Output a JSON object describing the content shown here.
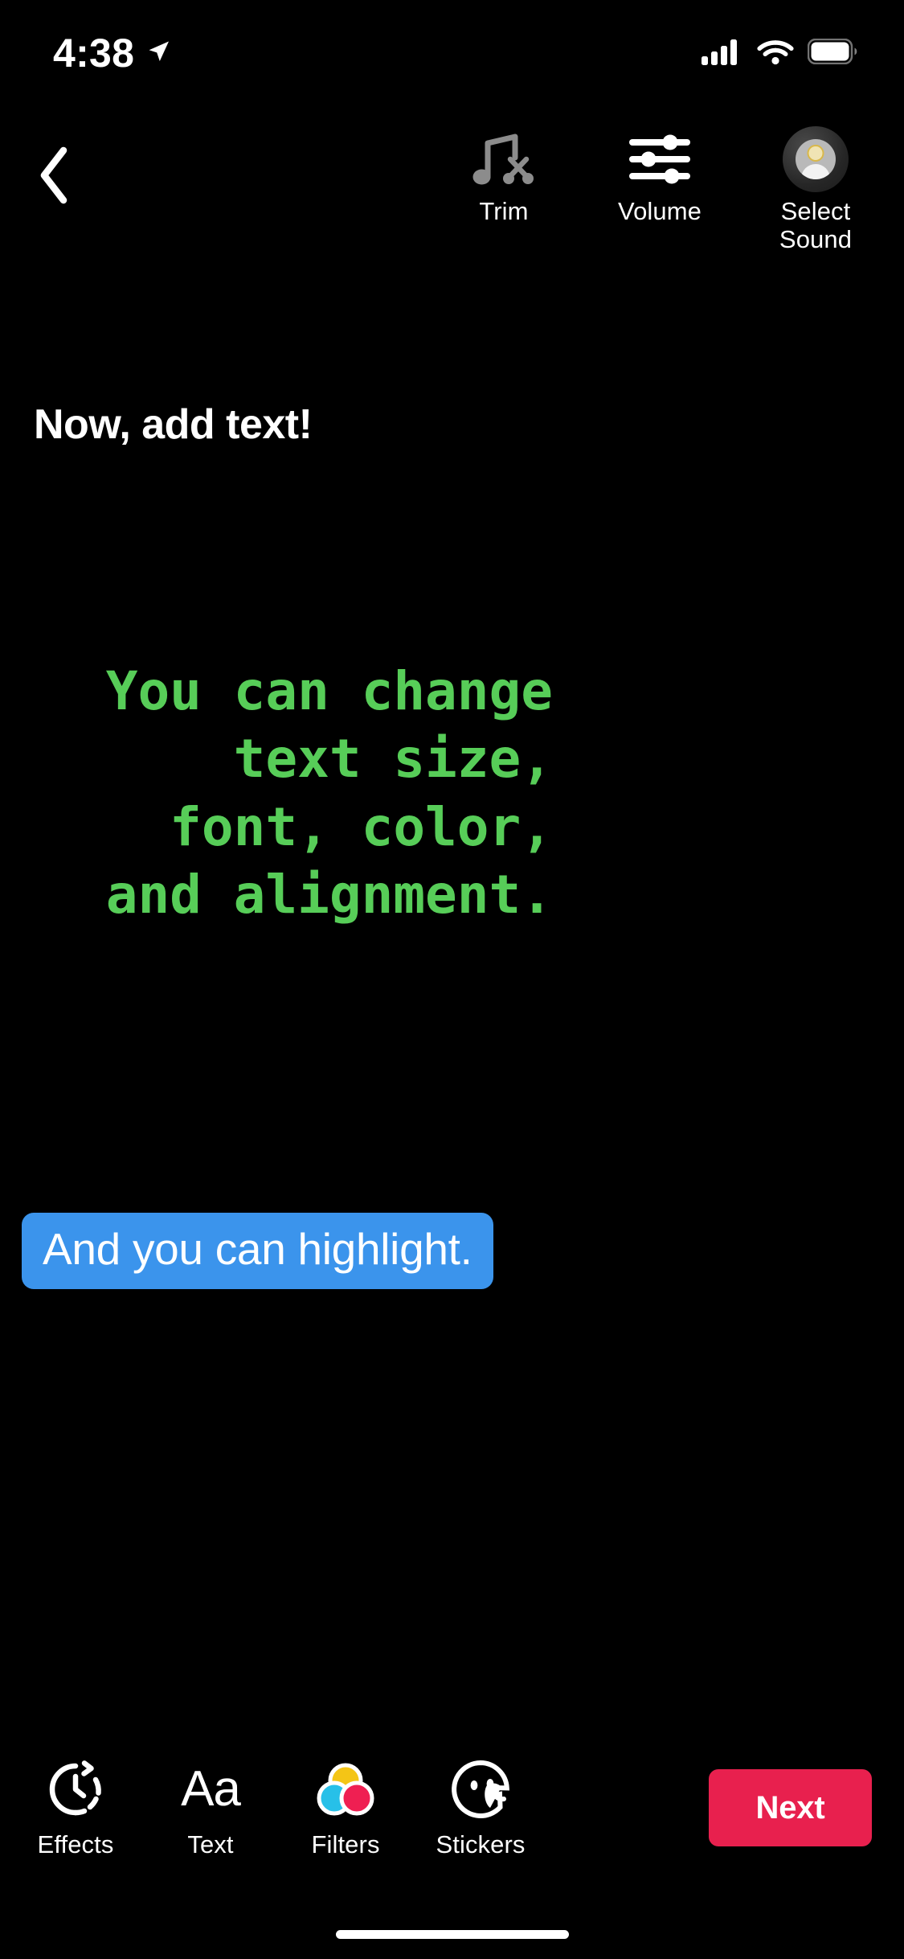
{
  "status_bar": {
    "time": "4:38",
    "location_icon": "location-arrow-icon",
    "cellular_icon": "cellular-signal-icon",
    "wifi_icon": "wifi-icon",
    "battery_icon": "battery-full-icon"
  },
  "top_bar": {
    "back_icon": "chevron-left-icon",
    "tools": [
      {
        "label": "Trim",
        "icon": "music-note-scissors-icon",
        "disabled": true
      },
      {
        "label": "Volume",
        "icon": "sliders-icon",
        "disabled": false
      },
      {
        "label": "Select\nSound",
        "label_line1": "Select",
        "label_line2": "Sound",
        "icon": "vinyl-record-avatar-icon",
        "disabled": false
      }
    ]
  },
  "canvas": {
    "heading": "Now, add text!",
    "green_text": "You can change text size, font, color, and alignment.",
    "green_color": "#57cd58",
    "highlight_text": "And you can highlight.",
    "highlight_color": "#3b94ec"
  },
  "bottom_bar": {
    "tools": [
      {
        "label": "Effects",
        "icon": "timer-clock-icon"
      },
      {
        "label": "Text",
        "icon": "aa-text-icon",
        "glyph": "Aa"
      },
      {
        "label": "Filters",
        "icon": "color-circles-icon"
      },
      {
        "label": "Stickers",
        "icon": "sticker-face-icon"
      }
    ],
    "next_label": "Next",
    "next_color": "#e8204e"
  },
  "filters_colors": {
    "yellow": "#f4c516",
    "cyan": "#27c0e8",
    "pink": "#ef1f52"
  }
}
